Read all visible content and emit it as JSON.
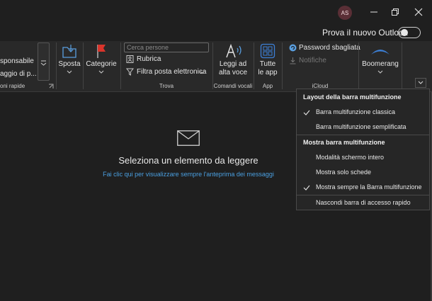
{
  "titlebar": {
    "avatar_initials": "AS"
  },
  "trybar": {
    "label": "Prova il nuovo Outlook"
  },
  "ribbon": {
    "group1": {
      "line1": "sponsabile",
      "line2": "aggio di p...",
      "label": "oni rapide"
    },
    "sposta": "Sposta",
    "categorie": "Categorie",
    "trova": {
      "search_placeholder": "Cerca persone",
      "rubrica": "Rubrica",
      "filtra": "Filtra posta elettronica",
      "label": "Trova"
    },
    "vocali": {
      "line1": "Leggi ad",
      "line2": "alta voce",
      "label": "Comandi vocali"
    },
    "app": {
      "line1": "Tutte",
      "line2": "le app",
      "label": "App"
    },
    "icloud": {
      "password": "Password sbagliata",
      "notifiche": "Notifiche",
      "label": "iCloud"
    },
    "boomerang": "Boomerang"
  },
  "menu": {
    "head1": "Layout della barra multifunzione",
    "item1": "Barra multifunzione classica",
    "item2": "Barra multifunzione semplificata",
    "head2": "Mostra barra multifunzione",
    "item3": "Modalità schermo intero",
    "item4": "Mostra solo schede",
    "item5": "Mostra sempre la Barra multifunzione",
    "item6": "Nascondi barra di accesso rapido"
  },
  "reading": {
    "title": "Seleziona un elemento da leggere",
    "link": "Fai clic qui per visualizzare sempre l'anteprima dei messaggi"
  },
  "colors": {
    "accent_link": "#4a9fe0",
    "avatar_bg": "#5a2f36",
    "flag": "#d9342b",
    "app_blue": "#3c7fd6"
  }
}
